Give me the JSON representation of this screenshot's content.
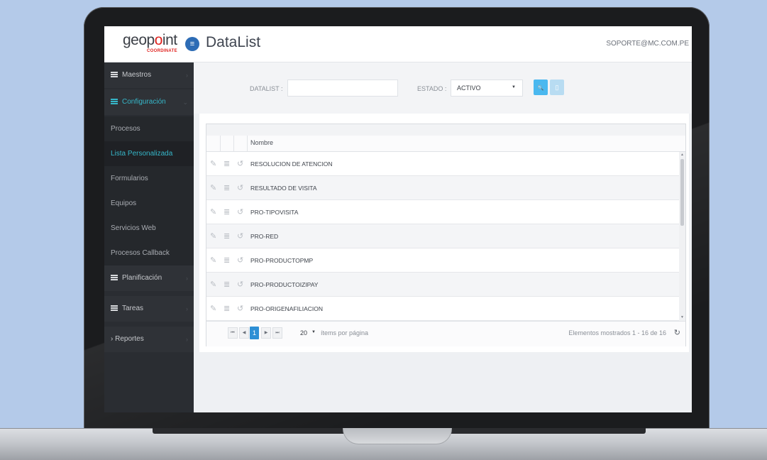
{
  "app": {
    "logo_text_a": "geop",
    "logo_text_o": "o",
    "logo_text_b": "int",
    "logo_sub": "COORDINATE",
    "menu_toggle_icon": "≡",
    "page_title": "DataList",
    "user_email": "SOPORTE@MC.COM.PE"
  },
  "sidebar": {
    "items": [
      {
        "label": "Maestros",
        "kind": "section",
        "icon": "list-icon",
        "chevron": "›"
      },
      {
        "label": "Configuración",
        "kind": "section-open",
        "icon": "list-icon",
        "chevron": "⌄"
      },
      {
        "label": "Procesos",
        "kind": "sub"
      },
      {
        "label": "Lista Personalizada",
        "kind": "sub-active"
      },
      {
        "label": "Formularios",
        "kind": "sub"
      },
      {
        "label": "Equipos",
        "kind": "sub"
      },
      {
        "label": "Servicios Web",
        "kind": "sub"
      },
      {
        "label": "Procesos Callback",
        "kind": "sub"
      },
      {
        "label": "Planificación",
        "kind": "section",
        "icon": "list-icon",
        "chevron": "›"
      },
      {
        "label": "Tareas",
        "kind": "section",
        "icon": "list-icon",
        "chevron": "›"
      },
      {
        "label": "Reportes",
        "kind": "section",
        "icon": "chevron-right-icon",
        "prefix": "›",
        "chevron": "›"
      }
    ]
  },
  "filters": {
    "datalist_label": "DATALIST :",
    "datalist_value": "",
    "estado_label": "ESTADO :",
    "estado_value": "ACTIVO",
    "estado_caret": "▼",
    "search_icon": "🔍",
    "clear_icon": "▯"
  },
  "grid": {
    "column_header": "Nombre",
    "row_icons": {
      "edit": "✎",
      "detail": "≣",
      "undo": "↺"
    },
    "rows": [
      "RESOLUCION DE ATENCION",
      "RESULTADO DE VISITA",
      "PRO-TIPOVISITA",
      "PRO-RED",
      "PRO-PRODUCTOPMP",
      "PRO-PRODUCTOIZIPAY",
      "PRO-ORIGENAFILIACION"
    ],
    "scroll_up": "▲",
    "scroll_down": "▼"
  },
  "pager": {
    "first": "⏮",
    "prev": "◀",
    "current_page": "1",
    "next": "▶",
    "last": "⏭",
    "page_size": "20",
    "page_size_caret": "▼",
    "per_page_label": "ítems por página",
    "info": "Elementos mostrados 1 - 16 de 16",
    "refresh_icon": "↻"
  },
  "colors": {
    "accent": "#36b7c9",
    "primary_button": "#4ab8ef",
    "current_page": "#2d8fd5",
    "sidebar_bg": "#2a2d32",
    "logo_red": "#e0231f"
  }
}
